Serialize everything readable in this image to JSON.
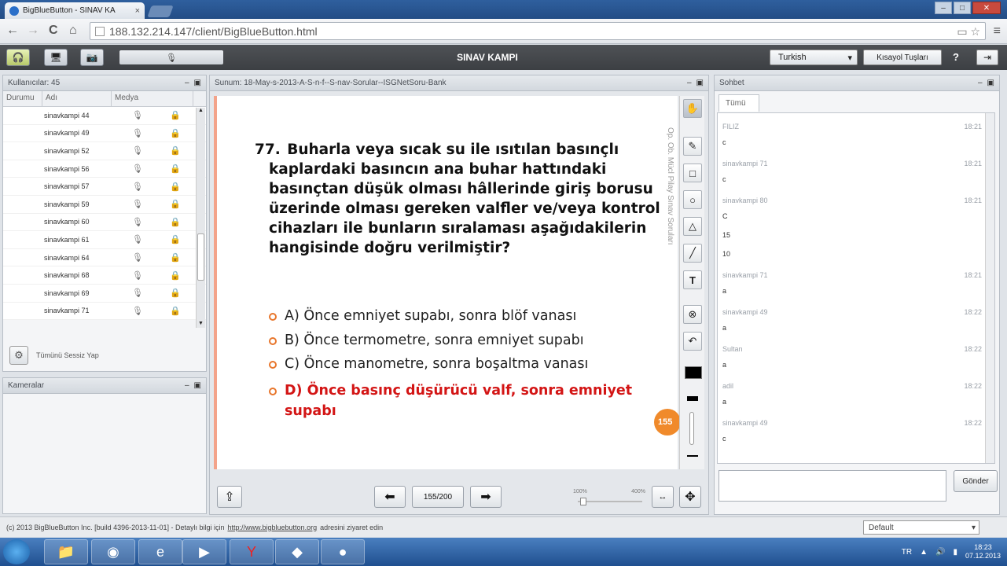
{
  "browser": {
    "tab_title": "BigBlueButton - SINAV KA",
    "tab_close": "×",
    "url": "188.132.214.147/client/BigBlueButton.html",
    "nav_back": "←",
    "nav_forward": "→",
    "nav_reload": "C",
    "nav_home": "⌂",
    "window_minimize": "–",
    "window_maximize": "□",
    "window_close": "✕",
    "omni_icons": "▭ ☆",
    "menu_icon": "≡"
  },
  "appbar": {
    "title": "SINAV KAMPI",
    "language": "Turkish",
    "shortcut_label": "Kısayol Tuşları",
    "help_label": "?",
    "logout_icon": "⇥",
    "mic_icon": "🎙"
  },
  "users": {
    "title": "Kullanıcılar: 45",
    "col_status": "Durumu",
    "col_name": "Adı",
    "col_media": "Medya",
    "rows": [
      "sinavkampi 44",
      "sinavkampi 49",
      "sinavkampi 52",
      "sinavkampi 56",
      "sinavkampi 57",
      "sinavkampi 59",
      "sinavkampi 60",
      "sinavkampi 61",
      "sinavkampi 64",
      "sinavkampi 68",
      "sinavkampi 69",
      "sinavkampi 71"
    ],
    "mute_all": "Tümünü Sessiz Yap"
  },
  "cameras": {
    "title": "Kameralar"
  },
  "presentation": {
    "title": "Sunum: 18-May-s-2013-A-S-n-f--S-nav-Sorular--ISGNetSoru-Bank",
    "question_number": "77.",
    "question_text": "Buharla veya sıcak su ile ısıtılan basınçlı kaplardaki basıncın ana buhar hattındaki basınçtan düşük olması hâllerinde giriş borusu üzerinde olması gereken valfler ve/veya kontrol cihazları ile bunların sıralaması aşağıdakilerin hangisinde doğru verilmiştir?",
    "answers": [
      {
        "text": "A) Önce emniyet supabı, sonra blöf vanası",
        "correct": false
      },
      {
        "text": "B) Önce termometre, sonra emniyet supabı",
        "correct": false
      },
      {
        "text": "C) Önce manometre, sonra boşaltma vanası",
        "correct": false
      },
      {
        "text": "D) Önce basınç düşürücü valf, sonra emniyet supabı",
        "correct": true
      }
    ],
    "side_text": "Op. Ob. Mücl Pilay  Sınav Soruları",
    "page_badge": "155",
    "page_indicator": "155/200",
    "zoom_min": "100%",
    "zoom_max": "400%"
  },
  "chat": {
    "title": "Sohbet",
    "tab": "Tümü",
    "send_label": "Gönder",
    "messages": [
      {
        "sender": "FILIZ",
        "time": "18:21",
        "lines": [
          "c"
        ]
      },
      {
        "sender": "sinavkampi 71",
        "time": "18:21",
        "lines": [
          "c"
        ]
      },
      {
        "sender": "sinavkampi 80",
        "time": "18:21",
        "lines": [
          "C",
          "15",
          "10"
        ]
      },
      {
        "sender": "sinavkampi 71",
        "time": "18:21",
        "lines": [
          "a"
        ]
      },
      {
        "sender": "sinavkampi 49",
        "time": "18:22",
        "lines": [
          "a"
        ]
      },
      {
        "sender": "Sultan",
        "time": "18:22",
        "lines": [
          "a"
        ]
      },
      {
        "sender": "adil",
        "time": "18:22",
        "lines": [
          "a"
        ]
      },
      {
        "sender": "sinavkampi 49",
        "time": "18:22",
        "lines": [
          "c"
        ]
      }
    ]
  },
  "footer": {
    "copyright": "(c) 2013 BigBlueButton Inc. [build 4396-2013-11-01] - Detaylı bilgi için",
    "link": "http://www.bigbluebutton.org",
    "suffix": "adresini ziyaret edin",
    "layout": "Default"
  },
  "taskbar": {
    "lang": "TR",
    "time": "18:23",
    "date": "07.12.2013"
  }
}
